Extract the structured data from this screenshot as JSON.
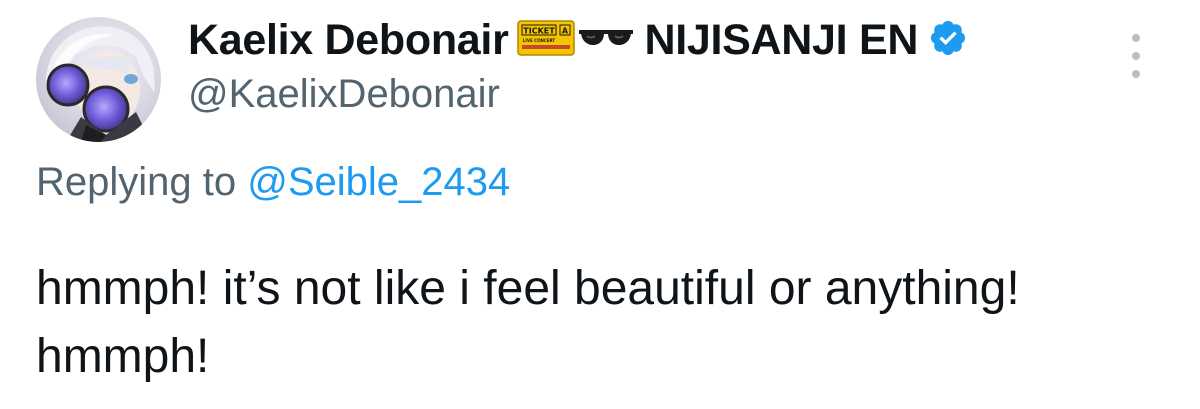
{
  "author": {
    "display_name": "Kaelix Debonair",
    "affiliation": "NIJISANJI EN",
    "handle": "@KaelixDebonair",
    "emojis": [
      "ticket-icon",
      "sunglasses-icon"
    ],
    "ticket_emoji": {
      "title": "TICKET",
      "letter": "A",
      "subtitle": "LIVE CONCERT"
    },
    "verified_color": "#1d9bf0"
  },
  "reply": {
    "prefix": "Replying to",
    "to_handle": "@Seible_2434"
  },
  "tweet": {
    "text": "hmmph! it’s not like i feel beautiful or anything! hmmph!"
  },
  "colors": {
    "text": "#0f1419",
    "secondary": "#536471",
    "link": "#1d9bf0"
  }
}
